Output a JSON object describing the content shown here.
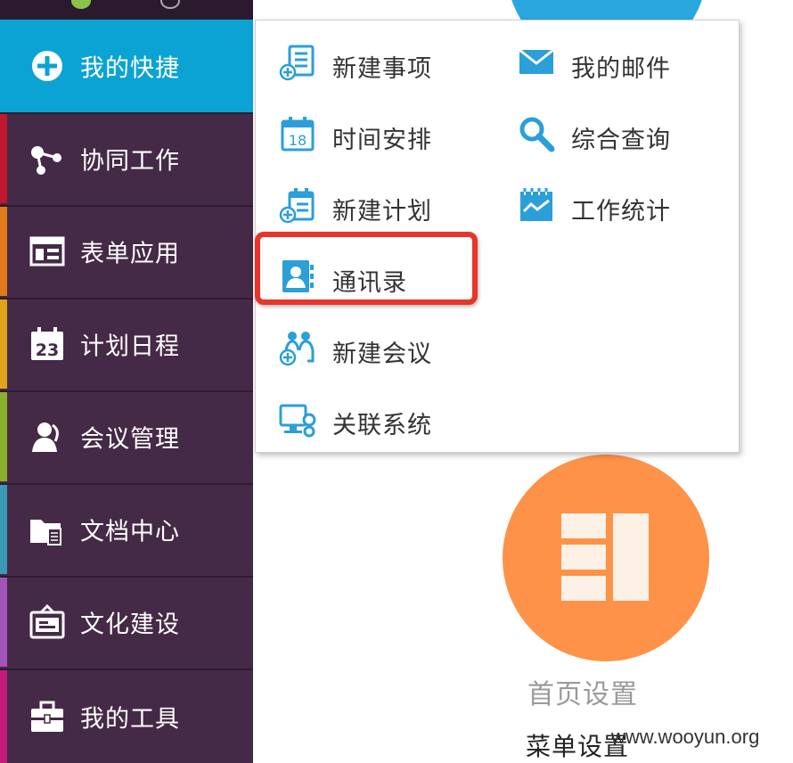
{
  "sidebar": {
    "items": [
      {
        "label": "我的快捷",
        "icon": "plus-circle-icon",
        "color": "#0ba3d3"
      },
      {
        "label": "协同工作",
        "icon": "share-nodes-icon",
        "color": "#c0182f"
      },
      {
        "label": "表单应用",
        "icon": "form-window-icon",
        "color": "#e07b1a"
      },
      {
        "label": "计划日程",
        "icon": "calendar-23-icon",
        "color": "#e0a41a"
      },
      {
        "label": "会议管理",
        "icon": "meeting-user-icon",
        "color": "#8aaf2d"
      },
      {
        "label": "文档中心",
        "icon": "folder-doc-icon",
        "color": "#3a9ab6"
      },
      {
        "label": "文化建设",
        "icon": "bulletin-board-icon",
        "color": "#a354b8"
      },
      {
        "label": "我的工具",
        "icon": "toolbox-icon",
        "color": "#c21b7a"
      }
    ]
  },
  "popup": {
    "left_column": [
      {
        "label": "新建事项",
        "icon": "new-item-icon"
      },
      {
        "label": "时间安排",
        "icon": "calendar-18-icon"
      },
      {
        "label": "新建计划",
        "icon": "new-plan-icon"
      },
      {
        "label": "通讯录",
        "icon": "contacts-icon"
      },
      {
        "label": "新建会议",
        "icon": "new-meeting-icon"
      },
      {
        "label": "关联系统",
        "icon": "linked-system-icon"
      }
    ],
    "right_column": [
      {
        "label": "我的邮件",
        "icon": "mail-icon"
      },
      {
        "label": "综合查询",
        "icon": "search-icon"
      },
      {
        "label": "工作统计",
        "icon": "work-stats-icon"
      }
    ]
  },
  "main": {
    "home_settings": "首页设置",
    "menu_settings": "菜单设置"
  },
  "watermark": "www.wooyun.org",
  "colors": {
    "sidebar_bg": "#452a47",
    "active_bg": "#0ba3d3",
    "icon_blue": "#2a9fd8",
    "highlight": "#e8352a",
    "orange": "#fe9248"
  }
}
